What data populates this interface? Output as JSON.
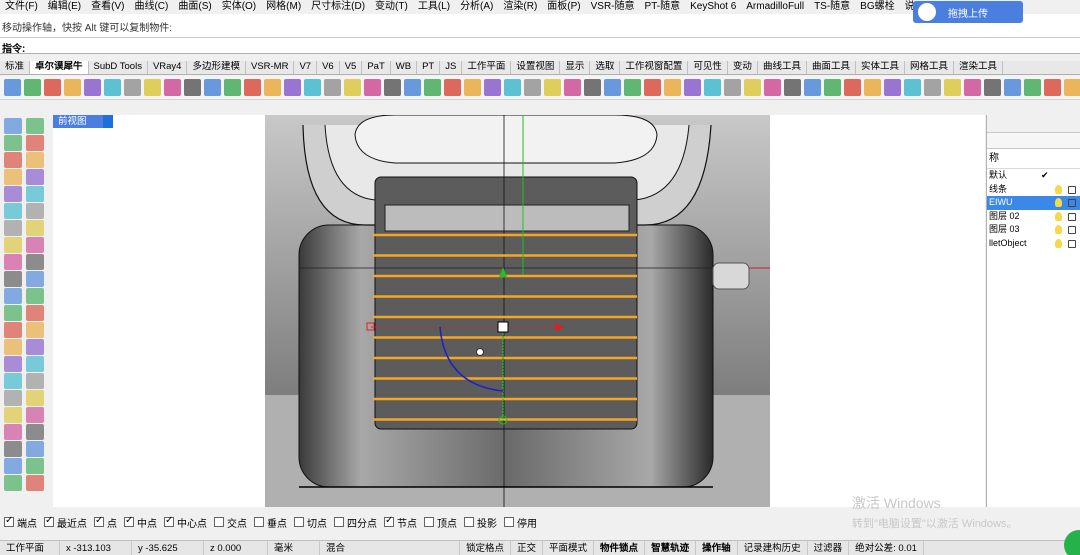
{
  "menu": [
    "文件(F)",
    "编辑(E)",
    "查看(V)",
    "曲线(C)",
    "曲面(S)",
    "实体(O)",
    "网格(M)",
    "尺寸标注(D)",
    "变动(T)",
    "工具(L)",
    "分析(A)",
    "渲染(R)",
    "面板(P)",
    "VSR-随意",
    "PT-随意",
    "KeyShot 6",
    "ArmadilloFull",
    "TS-随意",
    "BG螺栓",
    "说"
  ],
  "command_history": "移动操作轴，快按 Alt 键可以复制物件:",
  "command_prompt": "指令:",
  "cloud_button": "拖拽上传",
  "tabs": [
    "标准",
    "卓尔谟犀牛",
    "SubD Tools",
    "VRay4",
    "多边形建模",
    "VSR-MR",
    "V7",
    "V6",
    "V5",
    "PaT",
    "WB",
    "PT",
    "JS",
    "工作平面",
    "设置视图",
    "显示",
    "选取",
    "工作视窗配置",
    "可见性",
    "变动",
    "曲线工具",
    "曲面工具",
    "实体工具",
    "网格工具",
    "渲染工具"
  ],
  "active_tab": "卓尔谟犀牛",
  "viewport_title": "前视图",
  "layer_panel": {
    "column_header": "称",
    "layers": [
      {
        "name": "默认",
        "current": true
      },
      {
        "name": "线条",
        "current": false
      },
      {
        "name": "EIWU",
        "current": false,
        "selected": true
      },
      {
        "name": "图层 02",
        "current": false
      },
      {
        "name": "图层 03",
        "current": false
      },
      {
        "name": "lletObject",
        "current": false
      }
    ]
  },
  "osnap": [
    {
      "label": "端点",
      "on": true
    },
    {
      "label": "最近点",
      "on": true
    },
    {
      "label": "点",
      "on": true
    },
    {
      "label": "中点",
      "on": true
    },
    {
      "label": "中心点",
      "on": true
    },
    {
      "label": "交点",
      "on": false
    },
    {
      "label": "垂点",
      "on": false
    },
    {
      "label": "切点",
      "on": false
    },
    {
      "label": "四分点",
      "on": false
    },
    {
      "label": "节点",
      "on": true
    },
    {
      "label": "顶点",
      "on": false
    },
    {
      "label": "投影",
      "on": false
    },
    {
      "label": "停用",
      "on": false
    }
  ],
  "status": {
    "cplane": "工作平面",
    "x": "x -313.103",
    "y": "y -35.625",
    "z": "z 0.000",
    "unit": "毫米",
    "layer": "混合",
    "lock_grid": "锁定格点",
    "ortho": "正交",
    "planar": "平面模式",
    "osnap": "物件锁点",
    "smarttrack": "智慧轨迹",
    "gumball": "操作轴",
    "history": "记录建构历史",
    "filter": "过滤器",
    "tolerance": "绝对公差: 0.01"
  },
  "watermark": {
    "line1": "激活 Windows",
    "line2": "转到\"电脑设置\"以激活 Windows。"
  },
  "colors": {
    "accent": "#4a7fe0",
    "selection": "#3b88e8",
    "guide_lines": "#f5a623",
    "gumball_red": "#e02020",
    "gumball_green": "#20c020"
  }
}
